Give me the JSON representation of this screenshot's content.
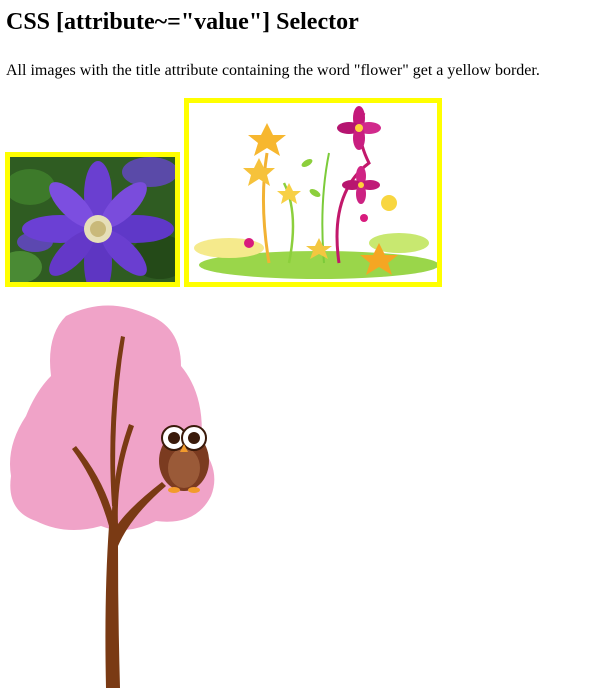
{
  "page": {
    "title": "CSS [attribute~=\"value\"] Selector",
    "description": "All images with the title attribute containing the word \"flower\" get a yellow border."
  },
  "images": [
    {
      "icon": "clematis-flower-photo",
      "border_color": "#ffff00",
      "has_border": true
    },
    {
      "icon": "flower-garden-illustration",
      "border_color": "#ffff00",
      "has_border": true
    },
    {
      "icon": "pink-tree-owl-illustration",
      "has_border": false
    }
  ],
  "colors": {
    "highlight_border": "#ffff00",
    "tree_foliage": "#f0a3c8",
    "tree_trunk": "#7a3a14"
  }
}
